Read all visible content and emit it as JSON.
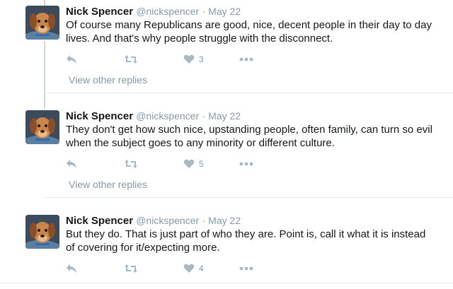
{
  "tweets": [
    {
      "name": "Nick Spencer",
      "handle": "@nickspencer",
      "separator": "·",
      "date": "May 22",
      "text": "Of course many Republicans are good, nice, decent people in their day to day lives. And that's why people struggle with the disconnect.",
      "likes": "3",
      "view_replies": "View other replies"
    },
    {
      "name": "Nick Spencer",
      "handle": "@nickspencer",
      "separator": "·",
      "date": "May 22",
      "text": "They don't get how such nice, upstanding people, often family, can turn so evil when the subject goes to any minority or different culture.",
      "likes": "5",
      "view_replies": "View other replies"
    },
    {
      "name": "Nick Spencer",
      "handle": "@nickspencer",
      "separator": "·",
      "date": "May 22",
      "text": "But they do. That is just part of who they are. Point is, call it what it is instead of covering for it/expecting more.",
      "likes": "4"
    }
  ],
  "icons": {
    "reply": "reply-icon",
    "retweet": "retweet-icon",
    "like": "heart-icon",
    "more": "more-dots-icon"
  },
  "colors": {
    "icon": "#aab8c2",
    "muted": "#8899a6",
    "text": "#14171a",
    "divider": "#e6ecf0"
  }
}
